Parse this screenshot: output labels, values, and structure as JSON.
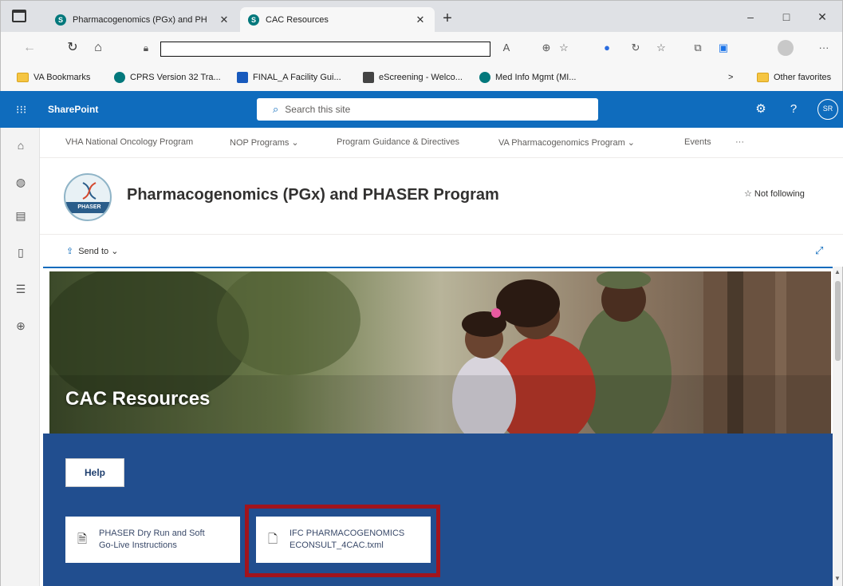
{
  "browser": {
    "tabs": [
      {
        "label": "Pharmacogenomics (PGx) and PH"
      },
      {
        "label": "CAC Resources"
      }
    ],
    "new_tab": "+",
    "window_controls": {
      "minimize": "–",
      "maximize": "□",
      "close": "✕"
    },
    "address_url": "",
    "toolbar_more": "···"
  },
  "favorites": [
    {
      "label": "VA Bookmarks",
      "icon": "folder-icon"
    },
    {
      "label": "CPRS Version 32 Tra...",
      "icon": "sharepoint-icon"
    },
    {
      "label": "FINAL_A Facility Gui...",
      "icon": "word-icon"
    },
    {
      "label": "eScreening - Welco...",
      "icon": "app-icon"
    },
    {
      "label": "Med Info Mgmt (MI...",
      "icon": "sharepoint-icon"
    }
  ],
  "favorites_overflow": ">",
  "other_favorites": "Other favorites",
  "suitebar": {
    "brand": "SharePoint",
    "search_placeholder": "Search this site",
    "avatar_initials": "SR",
    "help": "?"
  },
  "hubnav": [
    {
      "label": "VHA National Oncology Program"
    },
    {
      "label": "NOP Programs ⌄"
    },
    {
      "label": "Program Guidance & Directives"
    },
    {
      "label": "VA Pharmacogenomics Program ⌄"
    },
    {
      "label": "Events"
    },
    {
      "label": "···"
    }
  ],
  "site": {
    "title": "Pharmacogenomics (PGx) and PHASER Program",
    "follow_label": "☆ Not following",
    "logo_text": "PHASER"
  },
  "command": {
    "send_to": "Send to ⌄"
  },
  "page": {
    "hero_title": "CAC Resources",
    "help_button": "Help",
    "files": [
      {
        "line1": "PHASER Dry Run and Soft",
        "line2": "Go-Live Instructions"
      },
      {
        "line1": "IFC PHARMACOGENOMICS",
        "line2": "ECONSULT_4CAC.txml"
      }
    ]
  },
  "colors": {
    "suitebar": "#0f6cbd",
    "content_blue": "#214e8f",
    "highlight_box": "#a1141c"
  }
}
